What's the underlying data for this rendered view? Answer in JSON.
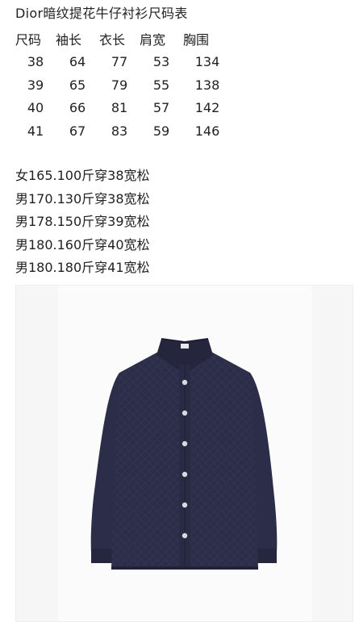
{
  "title": "Dior暗纹提花牛仔衬衫尺码表",
  "size_table": {
    "headers": [
      "尺码",
      "袖长",
      "衣长",
      "肩宽",
      "胸围"
    ],
    "rows": [
      [
        "38",
        "64",
        "77",
        "53",
        "134"
      ],
      [
        "39",
        "65",
        "79",
        "55",
        "138"
      ],
      [
        "40",
        "66",
        "81",
        "57",
        "142"
      ],
      [
        "41",
        "67",
        "83",
        "59",
        "146"
      ]
    ]
  },
  "fit_recommendations": [
    "女165.100斤穿38宽松",
    "男170.130斤穿38宽松",
    "男178.150斤穿39宽松",
    "男180.160斤穿40宽松",
    "男180.180斤穿41宽松"
  ],
  "product_image": {
    "subject": "navy jacquard denim shirt",
    "color": "#2c2d48"
  }
}
